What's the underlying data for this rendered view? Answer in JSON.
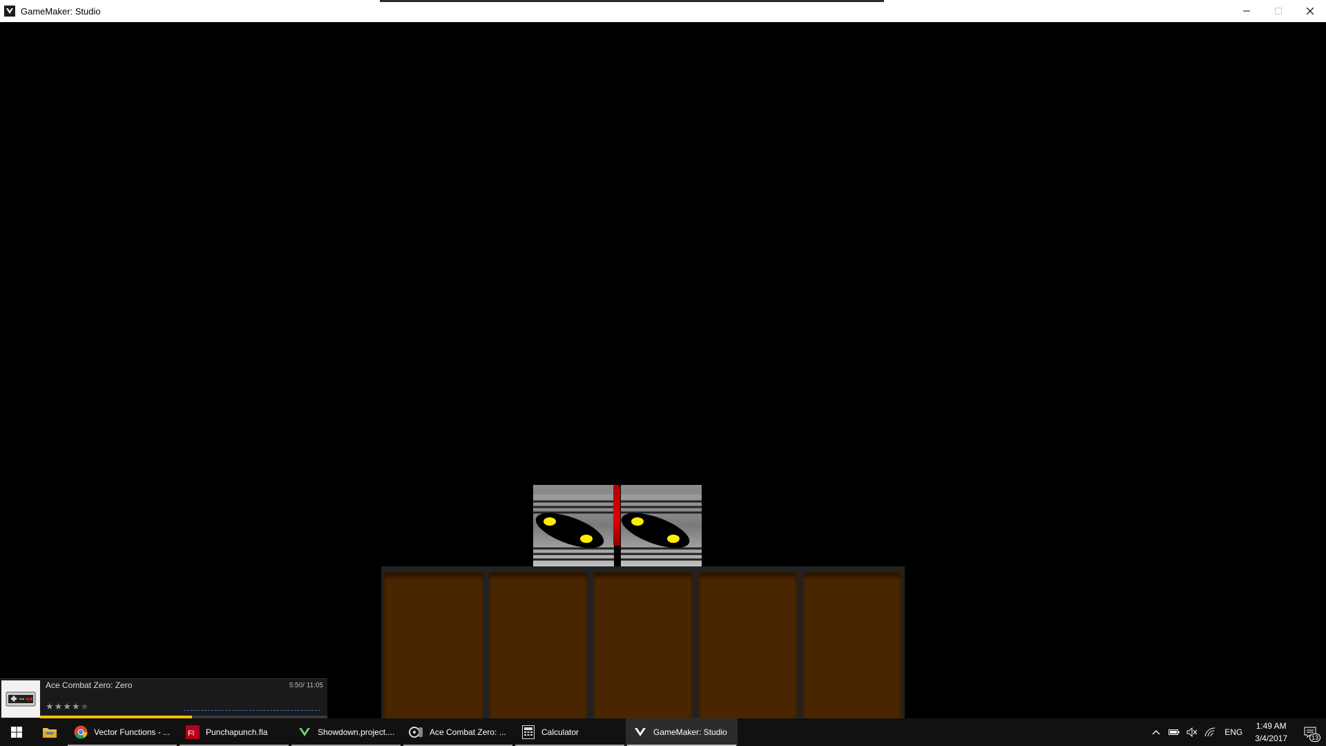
{
  "window": {
    "title": "GameMaker: Studio",
    "icon": "gamemaker-icon",
    "controls": [
      "minimize-icon",
      "maximize-icon",
      "close-icon"
    ]
  },
  "game": {
    "background_color": "#000000",
    "sprite_eye_color": "#ffee00",
    "blood_color": "#d00000",
    "crate_color": "#4a2600",
    "crate_count": 5
  },
  "media_player": {
    "title": "Ace Combat Zero: Zero",
    "time": "5:50/ 11:05",
    "progress": 0.53,
    "rating": 4,
    "rating_max": 5,
    "thumbnail_icon": "nes-controller-icon"
  },
  "taskbar": {
    "apps": [
      {
        "label": "Vector Functions - ...",
        "icon": "chrome-icon",
        "active": false
      },
      {
        "label": "Punchapunch.fla",
        "icon": "flash-icon",
        "active": false
      },
      {
        "label": "Showdown.project....",
        "icon": "gamemaker-icon",
        "active": false
      },
      {
        "label": "Ace Combat Zero: ...",
        "icon": "media-player-icon",
        "active": false
      },
      {
        "label": "Calculator",
        "icon": "calculator-icon",
        "active": false
      },
      {
        "label": "GameMaker: Studio",
        "icon": "gamemaker-icon",
        "active": true
      }
    ],
    "tray": {
      "language": "ENG",
      "time": "1:49 AM",
      "date": "3/4/2017",
      "notification_count": "13"
    }
  }
}
